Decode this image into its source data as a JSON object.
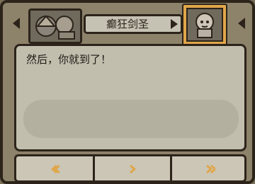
{
  "header": {
    "speaker_name": "癫狂剑圣"
  },
  "dialog": {
    "text": "然后，你就到了！"
  },
  "footer": {
    "buttons": [
      {
        "id": "prev"
      },
      {
        "id": "next"
      },
      {
        "id": "skip"
      }
    ]
  },
  "colors": {
    "frame": "#8d826a",
    "outline": "#2c241a",
    "panel": "#c2beae",
    "accent": "#e0a64b"
  },
  "icons": {
    "left-arrow": "left-arrow-icon",
    "right-arrow": "right-arrow-icon",
    "prev": "chevron-left-icon",
    "next": "chevron-right-icon",
    "skip": "double-chevron-right-icon"
  }
}
